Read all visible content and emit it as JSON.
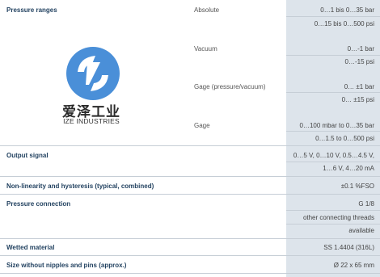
{
  "rows": [
    {
      "label": "Pressure ranges",
      "subs": [
        {
          "name": "Absolute",
          "values": [
            "0…1 bis 0…35 bar",
            "0…15 bis 0…500 psi"
          ]
        },
        {
          "name": "Vacuum",
          "values": [
            "0…-1 bar",
            "0…-15 psi"
          ]
        },
        {
          "name": "Gage (pressure/vacuum)",
          "values": [
            "0… ±1 bar",
            "0… ±15 psi"
          ]
        },
        {
          "name": "Gage",
          "values": [
            "0…100 mbar to 0…35 bar",
            "0…1.5 to 0…500 psi"
          ]
        }
      ]
    },
    {
      "label": "Output signal",
      "values": [
        "0…5 V, 0…10 V, 0.5…4.5 V,",
        "1…6 V, 4…20 mA"
      ]
    },
    {
      "label": "Non-linearity and hysteresis (typical, combined)",
      "values": [
        "±0.1 %FSO"
      ]
    },
    {
      "label": "Pressure connection",
      "values": [
        "G 1/8",
        "other connecting threads",
        "available"
      ]
    },
    {
      "label": "Wetted material",
      "values": [
        "SS 1.4404 (316L)"
      ]
    },
    {
      "label": "Size without nipples and pins (approx.)",
      "values": [
        "Ø 22 x 65 mm"
      ]
    }
  ],
  "logo": {
    "icon": "ize-logo-icon",
    "chinese": "爱泽工业",
    "english": "IZE INDUSTRIES",
    "color": "#4a8fd8"
  },
  "colors": {
    "label": "#1f3f5e",
    "value_column_bg": "#dde4eb"
  }
}
